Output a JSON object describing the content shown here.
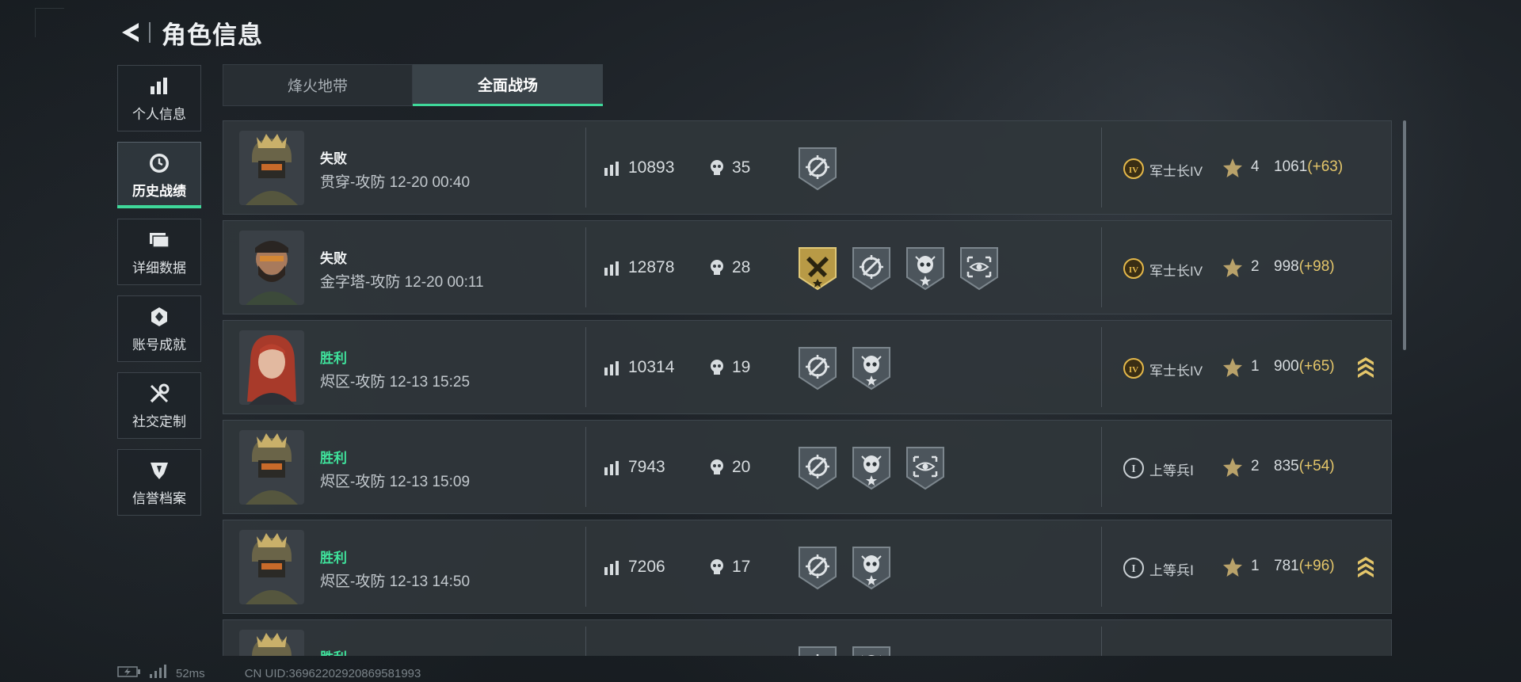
{
  "header": {
    "title": "角色信息"
  },
  "sidebar": {
    "items": [
      {
        "label": "个人信息",
        "icon": "bar-chart-icon",
        "active": false
      },
      {
        "label": "历史战绩",
        "icon": "clock-icon",
        "active": true
      },
      {
        "label": "详细数据",
        "icon": "cards-icon",
        "active": false
      },
      {
        "label": "账号成就",
        "icon": "achievement-icon",
        "active": false
      },
      {
        "label": "社交定制",
        "icon": "tools-icon",
        "active": false
      },
      {
        "label": "信誉档案",
        "icon": "shield-icon",
        "active": false
      }
    ]
  },
  "tabs": [
    {
      "label": "烽火地带",
      "active": false
    },
    {
      "label": "全面战场",
      "active": true
    }
  ],
  "matches": [
    {
      "result": "失败",
      "win": false,
      "map": "贯穿-攻防 12-20 00:40",
      "score": "10893",
      "kills": "35",
      "badges": [
        "target-badge-icon"
      ],
      "rank_icon": "IV",
      "rank": "军士长IV",
      "stars": "4",
      "points": "1061",
      "delta": "(+63)",
      "promotion": false,
      "avatar": "helmet"
    },
    {
      "result": "失败",
      "win": false,
      "map": "金字塔-攻防 12-20 00:11",
      "score": "12878",
      "kills": "28",
      "badges": [
        "gold-hammer-badge-icon",
        "target-badge-icon",
        "skull-badge-icon",
        "eye-scope-badge-icon"
      ],
      "rank_icon": "IV",
      "rank": "军士长IV",
      "stars": "2",
      "points": "998",
      "delta": "(+98)",
      "promotion": false,
      "avatar": "bearded"
    },
    {
      "result": "胜利",
      "win": true,
      "map": "烬区-攻防 12-13 15:25",
      "score": "10314",
      "kills": "19",
      "badges": [
        "target-badge-icon",
        "skull-badge-icon"
      ],
      "rank_icon": "IV",
      "rank": "军士长IV",
      "stars": "1",
      "points": "900",
      "delta": "(+65)",
      "promotion": true,
      "avatar": "redhair"
    },
    {
      "result": "胜利",
      "win": true,
      "map": "烬区-攻防 12-13 15:09",
      "score": "7943",
      "kills": "20",
      "badges": [
        "target-badge-icon",
        "skull-badge-icon",
        "eye-scope-badge-icon"
      ],
      "rank_icon": "I",
      "rank": "上等兵Ⅰ",
      "stars": "2",
      "points": "835",
      "delta": "(+54)",
      "promotion": false,
      "avatar": "helmet"
    },
    {
      "result": "胜利",
      "win": true,
      "map": "烬区-攻防 12-13 14:50",
      "score": "7206",
      "kills": "17",
      "badges": [
        "target-badge-icon",
        "skull-badge-icon"
      ],
      "rank_icon": "I",
      "rank": "上等兵Ⅰ",
      "stars": "1",
      "points": "781",
      "delta": "(+96)",
      "promotion": true,
      "avatar": "helmet"
    },
    {
      "result": "胜利",
      "win": true,
      "map": "",
      "score": "",
      "kills": "",
      "badges": [
        "target-badge-icon",
        "skull-badge-icon"
      ],
      "rank_icon": "",
      "rank": "",
      "stars": "",
      "points": "",
      "delta": "",
      "promotion": false,
      "avatar": "helmet"
    }
  ],
  "footer": {
    "ping": "52ms",
    "uid": "CN UID:36962202920869581993"
  },
  "colors": {
    "accent_green": "#3fd89a",
    "win_text": "#3fe39c",
    "gold": "#e4c66a"
  }
}
